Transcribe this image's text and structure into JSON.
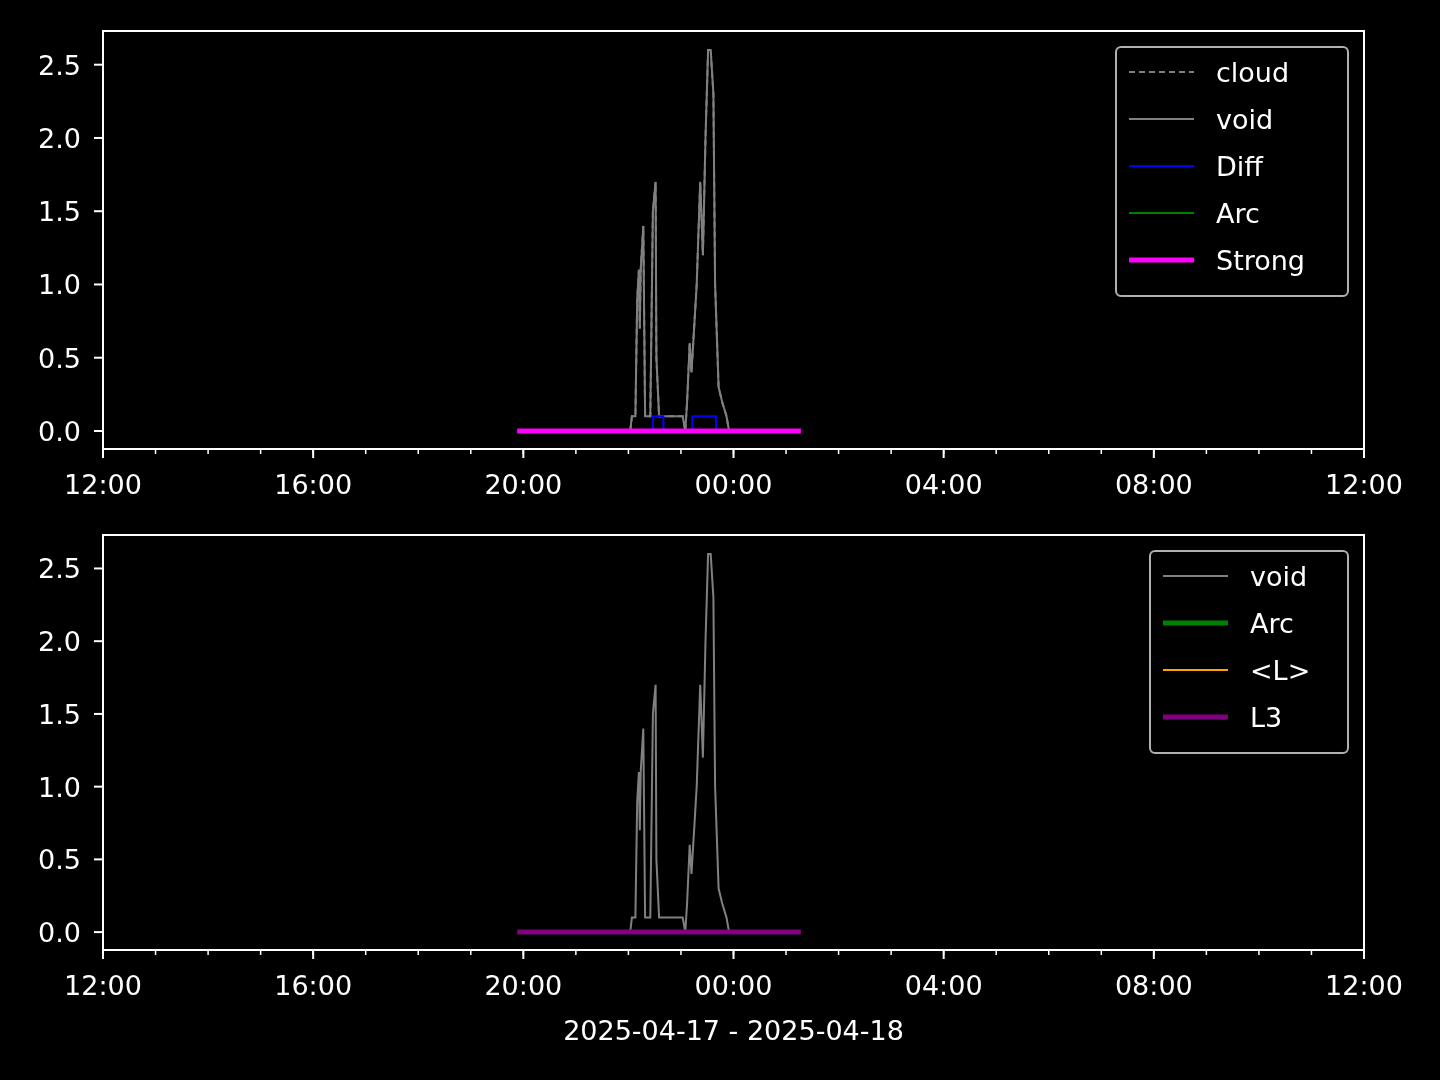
{
  "charts": [
    {
      "styles": [
        {
          "kind": "thin"
        },
        {
          "kind": "thin"
        },
        {
          "kind": "thin"
        },
        {
          "kind": "thin"
        },
        {
          "kind": "thick"
        }
      ],
      "chart_data": {
        "type": "line",
        "legend": "upper right",
        "xlim": [
          "2025-04-17T12:00",
          "2025-04-18T12:00"
        ],
        "ylim": [
          -0.123,
          2.73
        ],
        "xticks": [
          {
            "value": "2025-04-17T12:00",
            "label": "12:00"
          },
          {
            "value": "2025-04-17T16:00",
            "label": "16:00"
          },
          {
            "value": "2025-04-17T20:00",
            "label": "20:00"
          },
          {
            "value": "2025-04-18T00:00",
            "label": "00:00"
          },
          {
            "value": "2025-04-18T04:00",
            "label": "04:00"
          },
          {
            "value": "2025-04-18T08:00",
            "label": "08:00"
          },
          {
            "value": "2025-04-18T12:00",
            "label": "12:00"
          }
        ],
        "yticks": [
          {
            "value": 0,
            "label": "0.0"
          },
          {
            "value": 0.5,
            "label": "0.5"
          },
          {
            "value": 1,
            "label": "1.0"
          },
          {
            "value": 1.5,
            "label": "1.5"
          },
          {
            "value": 2,
            "label": "2.0"
          },
          {
            "value": 2.5,
            "label": "2.5"
          }
        ],
        "series": [
          {
            "name": "cloud",
            "color": "#808080",
            "line_style": "dashed",
            "x": [
              "2025-04-17T22:02",
              "2025-04-17T22:04",
              "2025-04-17T22:08",
              "2025-04-17T22:10",
              "2025-04-17T22:12",
              "2025-04-17T22:13",
              "2025-04-17T22:14",
              "2025-04-17T22:17",
              "2025-04-17T22:19",
              "2025-04-17T22:25",
              "2025-04-17T22:28",
              "2025-04-17T22:31",
              "2025-04-17T22:32",
              "2025-04-17T22:35",
              "2025-04-17T23:02",
              "2025-04-17T23:05",
              "2025-04-17T23:07",
              "2025-04-17T23:10",
              "2025-04-17T23:12",
              "2025-04-17T23:18",
              "2025-04-17T23:22",
              "2025-04-17T23:25",
              "2025-04-17T23:28",
              "2025-04-17T23:31",
              "2025-04-17T23:34",
              "2025-04-17T23:37",
              "2025-04-17T23:39",
              "2025-04-17T23:43",
              "2025-04-17T23:47",
              "2025-04-17T23:52",
              "2025-04-17T23:55"
            ],
            "values": [
              0,
              0.1,
              0.1,
              0.9,
              1.1,
              0.7,
              1.1,
              1.4,
              0.1,
              0.1,
              1.5,
              1.7,
              0.5,
              0.1,
              0.1,
              0,
              0.2,
              0.6,
              0.4,
              1,
              1.7,
              1.2,
              2,
              2.6,
              2.6,
              2.3,
              1,
              0.3,
              0.2,
              0.1,
              0
            ]
          },
          {
            "name": "void",
            "color": "#808080",
            "x": [
              "2025-04-17T22:02",
              "2025-04-17T22:04",
              "2025-04-17T22:08",
              "2025-04-17T22:10",
              "2025-04-17T22:12",
              "2025-04-17T22:13",
              "2025-04-17T22:14",
              "2025-04-17T22:17",
              "2025-04-17T22:19",
              "2025-04-17T22:25",
              "2025-04-17T22:28",
              "2025-04-17T22:31",
              "2025-04-17T22:32",
              "2025-04-17T22:35",
              "2025-04-17T23:02",
              "2025-04-17T23:05",
              "2025-04-17T23:07",
              "2025-04-17T23:10",
              "2025-04-17T23:12",
              "2025-04-17T23:18",
              "2025-04-17T23:22",
              "2025-04-17T23:25",
              "2025-04-17T23:28",
              "2025-04-17T23:31",
              "2025-04-17T23:34",
              "2025-04-17T23:37",
              "2025-04-17T23:39",
              "2025-04-17T23:43",
              "2025-04-17T23:47",
              "2025-04-17T23:52",
              "2025-04-17T23:55"
            ],
            "values": [
              0,
              0.1,
              0.1,
              0.9,
              1.1,
              0.7,
              1.1,
              1.4,
              0.1,
              0.1,
              1.5,
              1.7,
              0.5,
              0.1,
              0.1,
              0,
              0.2,
              0.6,
              0.4,
              1,
              1.7,
              1.2,
              2,
              2.6,
              2.6,
              2.3,
              1,
              0.3,
              0.2,
              0.1,
              0
            ]
          },
          {
            "name": "Diff",
            "color": "#0000ff",
            "x": [
              "2025-04-17T22:28",
              "2025-04-17T22:28",
              "2025-04-17T22:40",
              "2025-04-17T22:40",
              "2025-04-17T23:13",
              "2025-04-17T23:13",
              "2025-04-17T23:40",
              "2025-04-17T23:40"
            ],
            "values": [
              0,
              0.1,
              0.1,
              0,
              0,
              0.1,
              0.1,
              0
            ]
          },
          {
            "name": "Arc",
            "color": "#008000",
            "values": [
              null,
              null
            ]
          },
          {
            "name": "Strong",
            "color": "#ff00ff",
            "x": [
              "2025-04-17T19:53",
              "2025-04-18T01:17"
            ],
            "values": [
              0,
              0
            ]
          }
        ]
      }
    },
    {
      "styles": [
        {
          "kind": "thin"
        },
        {
          "kind": "thick"
        },
        {
          "kind": "thin"
        },
        {
          "kind": "thick"
        }
      ],
      "chart_data": {
        "type": "line",
        "legend": "upper right",
        "xlabel": "2025-04-17 - 2025-04-18",
        "xlim": [
          "2025-04-17T12:00",
          "2025-04-18T12:00"
        ],
        "ylim": [
          -0.123,
          2.73
        ],
        "xticks": [
          {
            "value": "2025-04-17T12:00",
            "label": "12:00"
          },
          {
            "value": "2025-04-17T16:00",
            "label": "16:00"
          },
          {
            "value": "2025-04-17T20:00",
            "label": "20:00"
          },
          {
            "value": "2025-04-18T00:00",
            "label": "00:00"
          },
          {
            "value": "2025-04-18T04:00",
            "label": "04:00"
          },
          {
            "value": "2025-04-18T08:00",
            "label": "08:00"
          },
          {
            "value": "2025-04-18T12:00",
            "label": "12:00"
          }
        ],
        "yticks": [
          {
            "value": 0,
            "label": "0.0"
          },
          {
            "value": 0.5,
            "label": "0.5"
          },
          {
            "value": 1,
            "label": "1.0"
          },
          {
            "value": 1.5,
            "label": "1.5"
          },
          {
            "value": 2,
            "label": "2.0"
          },
          {
            "value": 2.5,
            "label": "2.5"
          }
        ],
        "series": [
          {
            "name": "void",
            "color": "#808080",
            "x": [
              "2025-04-17T22:02",
              "2025-04-17T22:04",
              "2025-04-17T22:08",
              "2025-04-17T22:10",
              "2025-04-17T22:12",
              "2025-04-17T22:13",
              "2025-04-17T22:14",
              "2025-04-17T22:17",
              "2025-04-17T22:19",
              "2025-04-17T22:25",
              "2025-04-17T22:28",
              "2025-04-17T22:31",
              "2025-04-17T22:32",
              "2025-04-17T22:35",
              "2025-04-17T23:02",
              "2025-04-17T23:05",
              "2025-04-17T23:07",
              "2025-04-17T23:10",
              "2025-04-17T23:12",
              "2025-04-17T23:18",
              "2025-04-17T23:22",
              "2025-04-17T23:25",
              "2025-04-17T23:28",
              "2025-04-17T23:31",
              "2025-04-17T23:34",
              "2025-04-17T23:37",
              "2025-04-17T23:39",
              "2025-04-17T23:43",
              "2025-04-17T23:47",
              "2025-04-17T23:52",
              "2025-04-17T23:55"
            ],
            "values": [
              0,
              0.1,
              0.1,
              0.9,
              1.1,
              0.7,
              1.1,
              1.4,
              0.1,
              0.1,
              1.5,
              1.7,
              0.5,
              0.1,
              0.1,
              0,
              0.2,
              0.6,
              0.4,
              1,
              1.7,
              1.2,
              2,
              2.6,
              2.6,
              2.3,
              1,
              0.3,
              0.2,
              0.1,
              0
            ]
          },
          {
            "name": "Arc",
            "color": "#008000",
            "values": [
              null,
              null
            ]
          },
          {
            "name": "<L>",
            "color": "#ffa500",
            "values": [
              null,
              null
            ]
          },
          {
            "name": "L3",
            "color": "#800080",
            "x": [
              "2025-04-17T19:53",
              "2025-04-18T01:17"
            ],
            "values": [
              0,
              0
            ]
          }
        ]
      }
    }
  ]
}
